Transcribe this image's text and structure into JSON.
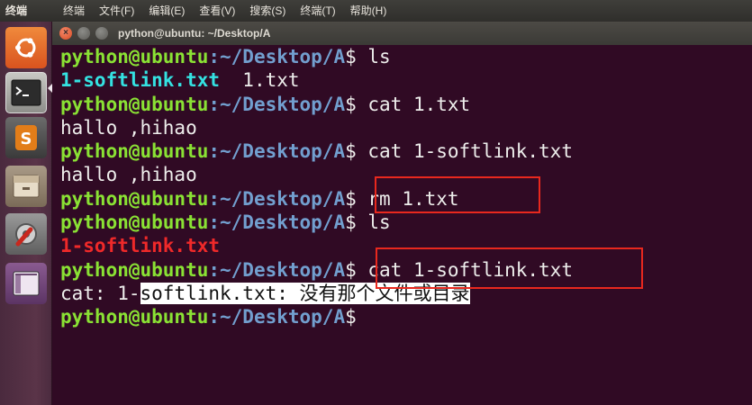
{
  "menubar": {
    "app_name": "终端",
    "items": [
      "终端",
      "文件(F)",
      "编辑(E)",
      "查看(V)",
      "搜索(S)",
      "终端(T)",
      "帮助(H)"
    ]
  },
  "launcher": {
    "icons": [
      "ubuntu-logo-icon",
      "terminal-icon",
      "sublime-text-icon",
      "file-manager-icon",
      "system-settings-icon",
      "workspace-switcher-icon"
    ]
  },
  "window": {
    "title": "python@ubuntu: ~/Desktop/A"
  },
  "prompt": {
    "user": "python@ubuntu",
    "path": ":~/Desktop/A",
    "symbol": "$"
  },
  "terminal_lines": [
    {
      "type": "prompt",
      "command": " ls"
    },
    {
      "type": "ls",
      "items": [
        {
          "text": "1-softlink.txt",
          "kind": "link"
        },
        {
          "text": "  1.txt",
          "kind": "plain"
        }
      ]
    },
    {
      "type": "prompt",
      "command": " cat 1.txt"
    },
    {
      "type": "output",
      "text": "hallo ,hihao"
    },
    {
      "type": "prompt",
      "command": " cat 1-softlink.txt"
    },
    {
      "type": "output",
      "text": "hallo ,hihao"
    },
    {
      "type": "prompt",
      "command": " rm 1.txt"
    },
    {
      "type": "prompt",
      "command": " ls"
    },
    {
      "type": "ls",
      "items": [
        {
          "text": "1-softlink.txt",
          "kind": "broken"
        }
      ]
    },
    {
      "type": "prompt",
      "command": " cat 1-softlink.txt"
    },
    {
      "type": "error",
      "prefix": "cat: 1-",
      "highlighted": "softlink.txt: 没有那个文件或目录"
    },
    {
      "type": "prompt",
      "command": ""
    }
  ],
  "colors": {
    "terminal_bg": "#300a24",
    "prompt_user": "#8ae234",
    "prompt_path": "#729fcf",
    "symlink": "#34e2e2",
    "broken_symlink": "#ef2929",
    "annotation_box": "#e8281e"
  }
}
